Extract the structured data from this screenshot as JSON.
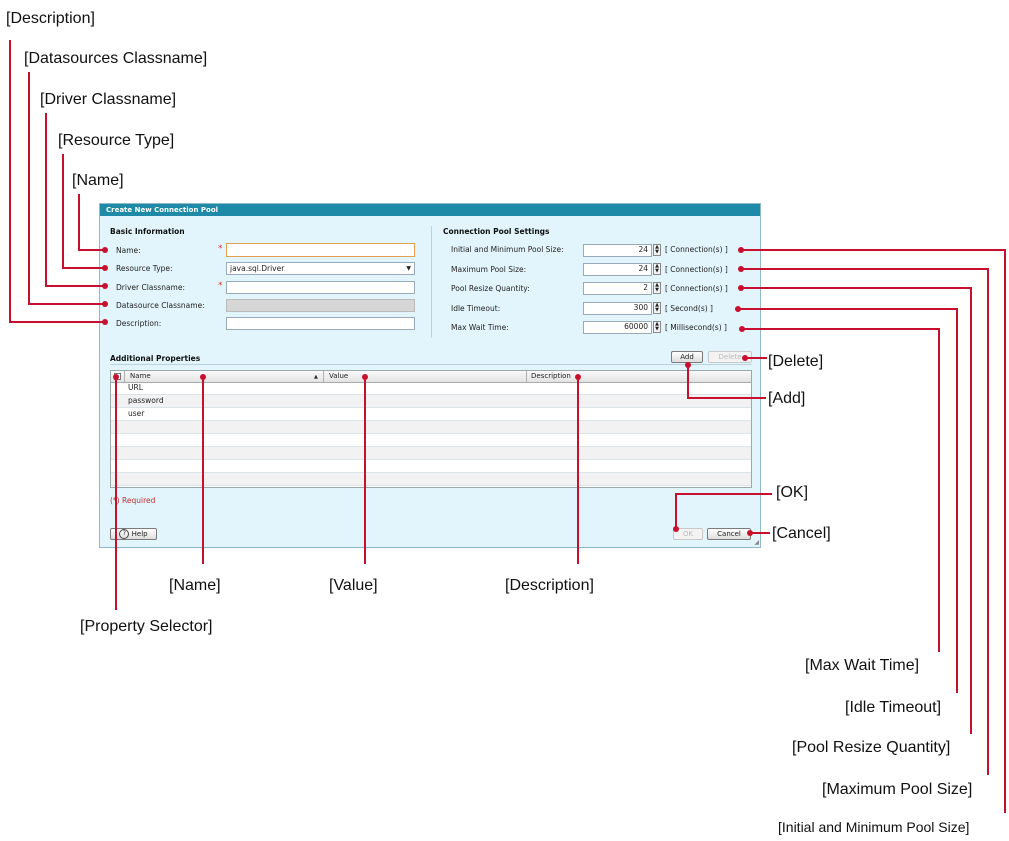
{
  "callouts": {
    "description_top": "[Description]",
    "datasources_classname": "[Datasources Classname]",
    "driver_classname": "[Driver Classname]",
    "resource_type": "[Resource Type]",
    "name_top": "[Name]",
    "delete": "[Delete]",
    "add": "[Add]",
    "ok": "[OK]",
    "cancel": "[Cancel]",
    "name_bottom": "[Name]",
    "value": "[Value]",
    "description_bottom": "[Description]",
    "property_selector": "[Property Selector]",
    "max_wait_time": "[Max Wait Time]",
    "idle_timeout": "[Idle Timeout]",
    "pool_resize_quantity": "[Pool Resize Quantity]",
    "maximum_pool_size": "[Maximum Pool Size]",
    "initial_min_pool_size": "[Initial and Minimum Pool Size]"
  },
  "callout_color": "#c8102e",
  "dialog": {
    "title": "Create New Connection Pool",
    "basic": {
      "heading": "Basic Information",
      "name_label": "Name:",
      "name_value": "",
      "resource_type_label": "Resource Type:",
      "resource_type_value": "java.sql.Driver",
      "driver_label": "Driver Classname:",
      "driver_value": "",
      "datasource_label": "Datasource Classname:",
      "datasource_value": "",
      "description_label": "Description:",
      "description_value": "",
      "required_marker": "*"
    },
    "pool": {
      "heading": "Connection Pool Settings",
      "initial_label": "Initial and Minimum Pool Size:",
      "initial_value": "24",
      "initial_unit": "[ Connection(s) ]",
      "max_label": "Maximum Pool Size:",
      "max_value": "24",
      "max_unit": "[ Connection(s) ]",
      "resize_label": "Pool Resize Quantity:",
      "resize_value": "2",
      "resize_unit": "[ Connection(s) ]",
      "idle_label": "Idle Timeout:",
      "idle_value": "300",
      "idle_unit": "[ Second(s) ]",
      "wait_label": "Max Wait Time:",
      "wait_value": "60000",
      "wait_unit": "[ Millisecond(s) ]"
    },
    "props": {
      "heading": "Additional Properties",
      "add_label": "Add",
      "delete_label": "Delete",
      "col_name": "Name",
      "col_value": "Value",
      "col_description": "Description",
      "sort_indicator": "▲",
      "rows": [
        {
          "name": "URL"
        },
        {
          "name": "password"
        },
        {
          "name": "user"
        },
        {
          "name": ""
        },
        {
          "name": ""
        },
        {
          "name": ""
        },
        {
          "name": ""
        },
        {
          "name": ""
        }
      ]
    },
    "required_note": "(*) Required",
    "help_label": "Help",
    "ok_label": "OK",
    "cancel_label": "Cancel"
  }
}
